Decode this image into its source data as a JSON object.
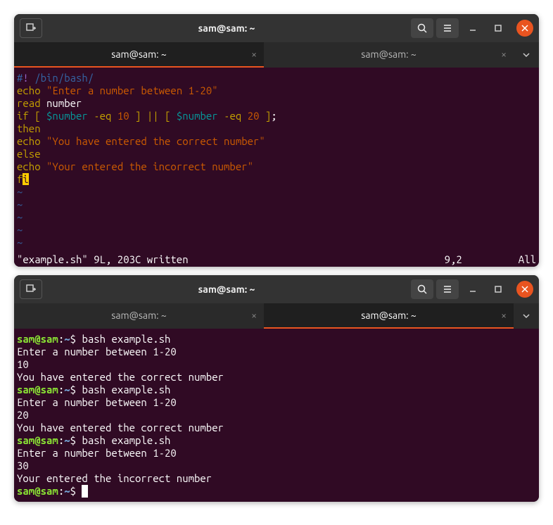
{
  "window1": {
    "title": "sam@sam: ~",
    "tabs": [
      {
        "label": "sam@sam: ~",
        "active": true
      },
      {
        "label": "sam@sam: ~",
        "active": false
      }
    ],
    "content": {
      "shebang_sharp": "#",
      "shebang_bang": "!",
      "shebang_path": " /bin/bash/",
      "l2_echo": "echo",
      "l2_str": "\"Enter a number between 1-20\"",
      "l3_read": "read",
      "l3_var": " number",
      "l4_if": "if",
      "l4_b1": " [ ",
      "l4_var1": "$number",
      "l4_eq1": " -eq ",
      "l4_n1": "10",
      "l4_b2": " ] ",
      "l4_or": "||",
      "l4_b3": " [ ",
      "l4_var2": "$number",
      "l4_eq2": " -eq ",
      "l4_n2": "20",
      "l4_b4": " ]",
      "l4_semi": ";",
      "l5_then": "then",
      "l6_echo": "echo",
      "l6_str": "\"You have entered the correct number\"",
      "l7_else": "else",
      "l8_echo": "echo",
      "l8_str": "\"Your entered the incorrect number\"",
      "l9_fi_f": "f",
      "l9_fi_i": "i",
      "tilde": "~"
    },
    "status": {
      "left": "\"example.sh\" 9L, 203C written",
      "mid": "9,2",
      "right": "All"
    }
  },
  "window2": {
    "title": "sam@sam: ~",
    "tabs": [
      {
        "label": "sam@sam: ~",
        "active": false
      },
      {
        "label": "sam@sam: ~",
        "active": true
      }
    ],
    "prompt_user": "sam@sam",
    "prompt_sep": ":",
    "prompt_path": "~",
    "prompt_dollar": "$ ",
    "cmd": "bash example.sh",
    "run1_prompt": "Enter a number between 1-20",
    "run1_input": "10",
    "run1_out": "You have entered the correct number",
    "run2_prompt": "Enter a number between 1-20",
    "run2_input": "20",
    "run2_out": "You have entered the correct number",
    "run3_prompt": "Enter a number between 1-20",
    "run3_input": "30",
    "run3_out": "Your entered the incorrect number"
  }
}
